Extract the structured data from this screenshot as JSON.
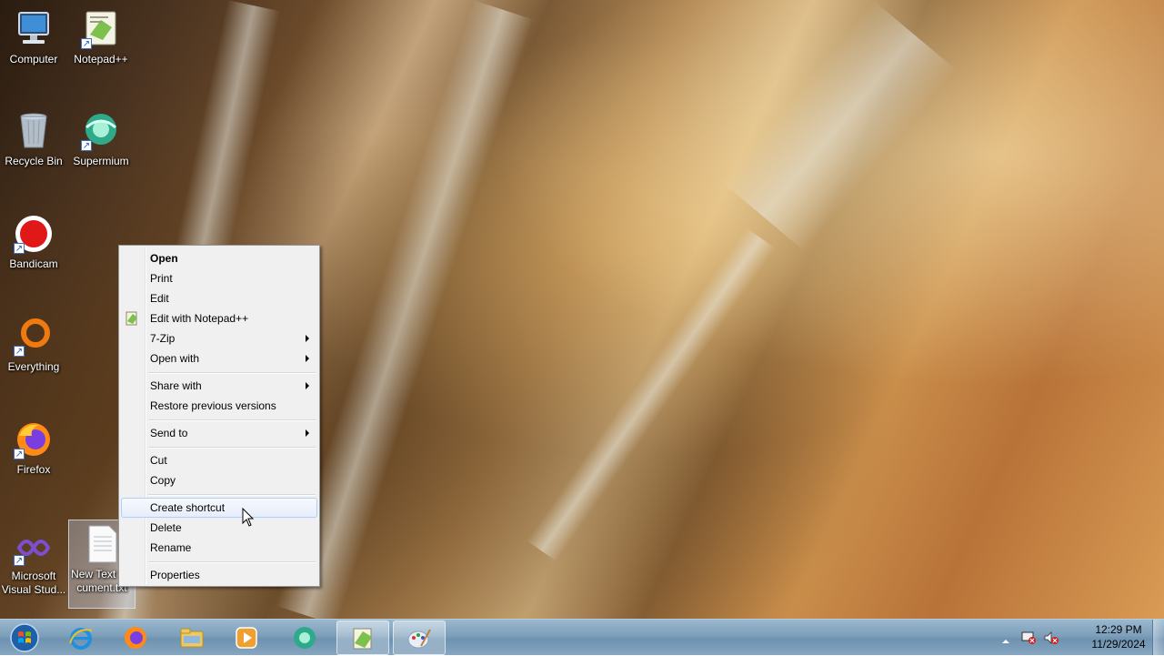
{
  "desktop": {
    "icons": [
      {
        "label": "Computer"
      },
      {
        "label": "Notepad++"
      },
      {
        "label": "Recycle Bin"
      },
      {
        "label": "Supermium"
      },
      {
        "label": "Bandicam"
      },
      {
        "label": "Everything"
      },
      {
        "label": "Firefox"
      },
      {
        "label": "Microsoft Visual Stud..."
      },
      {
        "label": "New Text Document.txt"
      }
    ]
  },
  "context_menu": {
    "items": [
      {
        "label": "Open",
        "bold": true
      },
      {
        "label": "Print"
      },
      {
        "label": "Edit"
      },
      {
        "label": "Edit with Notepad++",
        "icon": "notepadpp-icon"
      },
      {
        "label": "7-Zip",
        "submenu": true
      },
      {
        "label": "Open with",
        "submenu": true
      },
      {
        "label": "Share with",
        "submenu": true
      },
      {
        "label": "Restore previous versions"
      },
      {
        "label": "Send to",
        "submenu": true
      },
      {
        "label": "Cut"
      },
      {
        "label": "Copy"
      },
      {
        "label": "Create shortcut",
        "hovered": true
      },
      {
        "label": "Delete"
      },
      {
        "label": "Rename"
      },
      {
        "label": "Properties"
      }
    ]
  },
  "taskbar": {
    "buttons": [
      {
        "name": "start-orb-icon"
      },
      {
        "name": "internet-explorer-icon"
      },
      {
        "name": "firefox-icon"
      },
      {
        "name": "file-explorer-icon"
      },
      {
        "name": "media-player-icon"
      },
      {
        "name": "supermium-icon"
      },
      {
        "name": "notepadpp-icon",
        "active": true
      },
      {
        "name": "paint-icon",
        "active": true
      }
    ],
    "tray_icons": [
      "show-hidden-icons-icon",
      "action-center-flag-icon",
      "volume-muted-icon"
    ],
    "clock": {
      "time": "12:29 PM",
      "date": "11/29/2024"
    }
  },
  "colors": {
    "menu_background": "#f0f0f0",
    "menu_hover_border": "#aecff7",
    "taskbar": "#7d9fba"
  }
}
